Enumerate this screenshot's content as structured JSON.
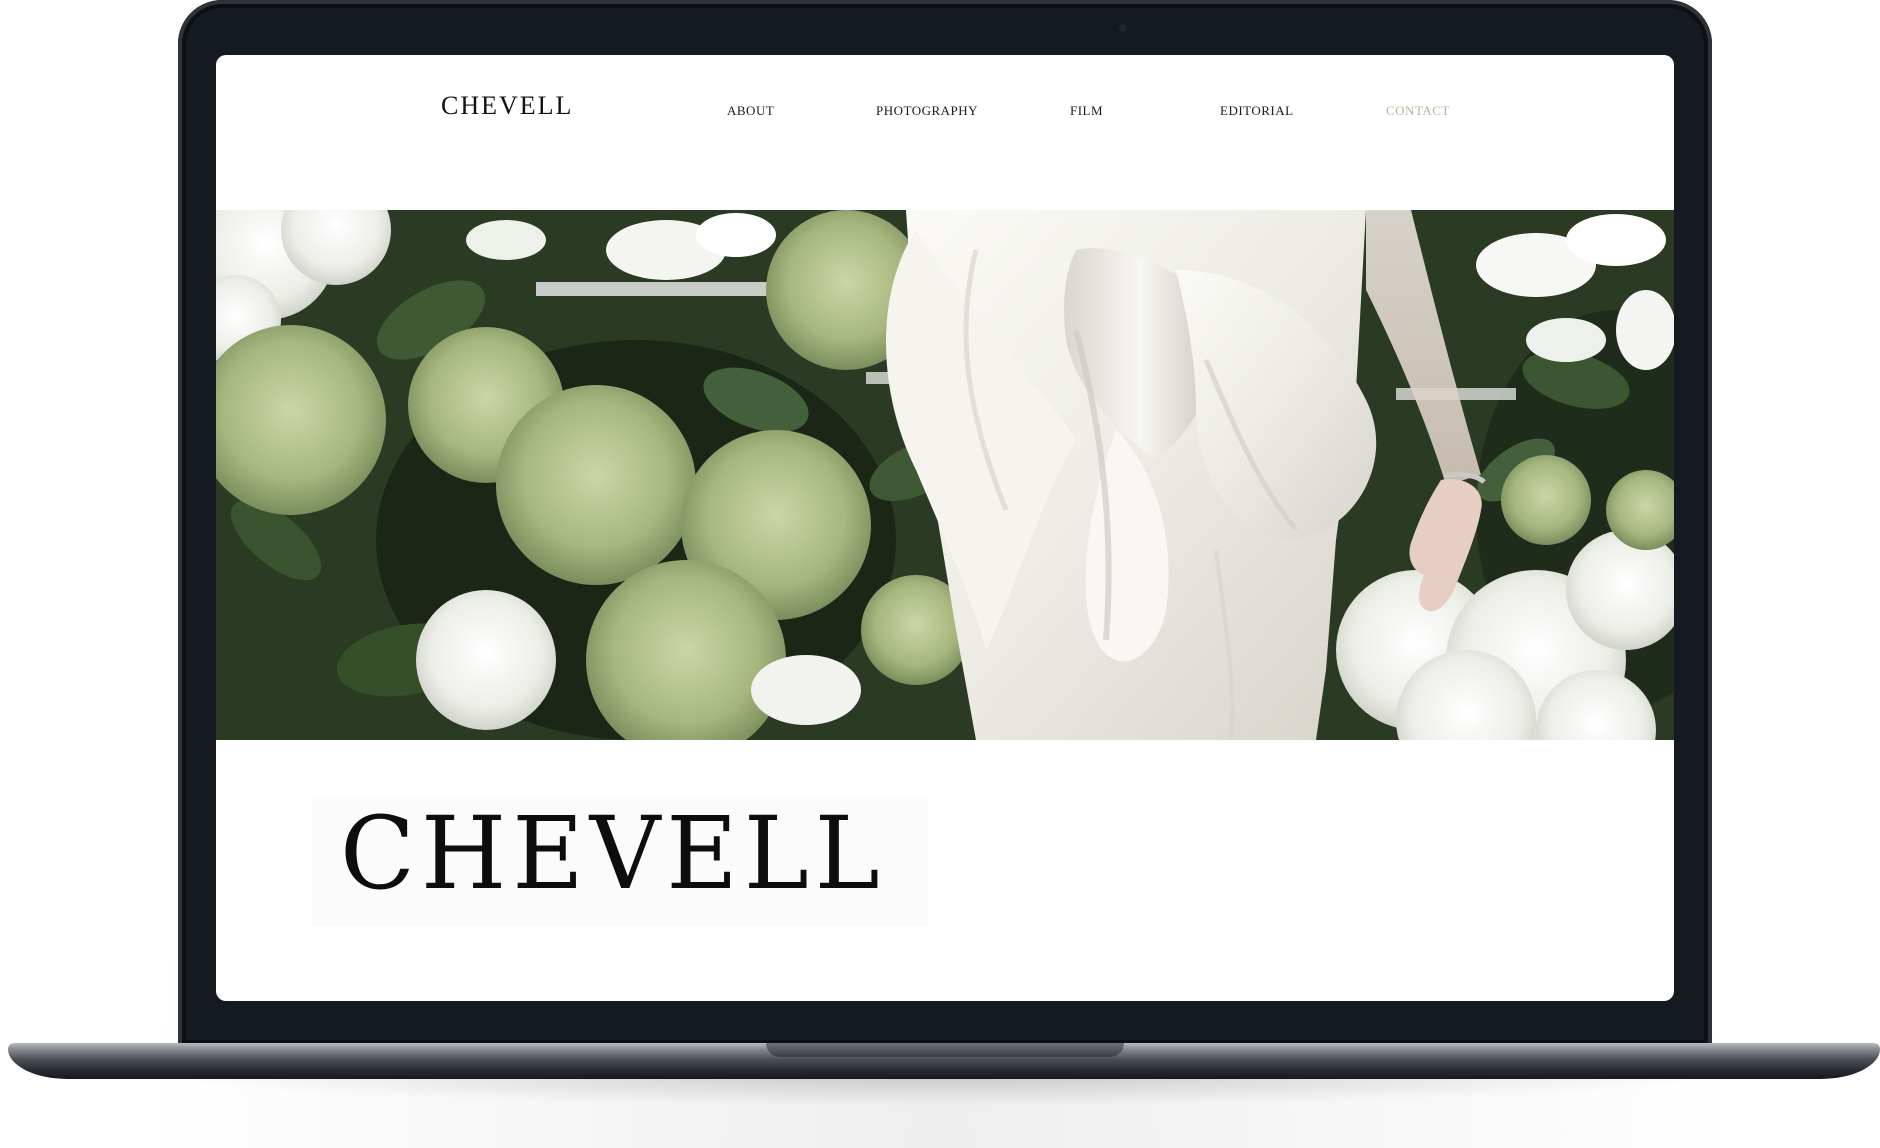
{
  "site": {
    "logo": "CHEVELL",
    "wordmark": "CHEVELL"
  },
  "nav": {
    "items": [
      {
        "label": "ABOUT",
        "active": false
      },
      {
        "label": "PHOTOGRAPHY",
        "active": false
      },
      {
        "label": "FILM",
        "active": false
      },
      {
        "label": "EDITORIAL",
        "active": false
      },
      {
        "label": "CONTACT",
        "active": true
      }
    ]
  },
  "hero": {
    "image_subject": "bride-in-white-satin-bow-gown-among-hydrangeas"
  },
  "colors": {
    "laptop_body": "#141a1f",
    "nav_active": "#b9b39d",
    "text": "#111111",
    "foliage_dark": "#23301d",
    "hydrangea_green": "#a9b985",
    "satin_white": "#f1efe9"
  }
}
